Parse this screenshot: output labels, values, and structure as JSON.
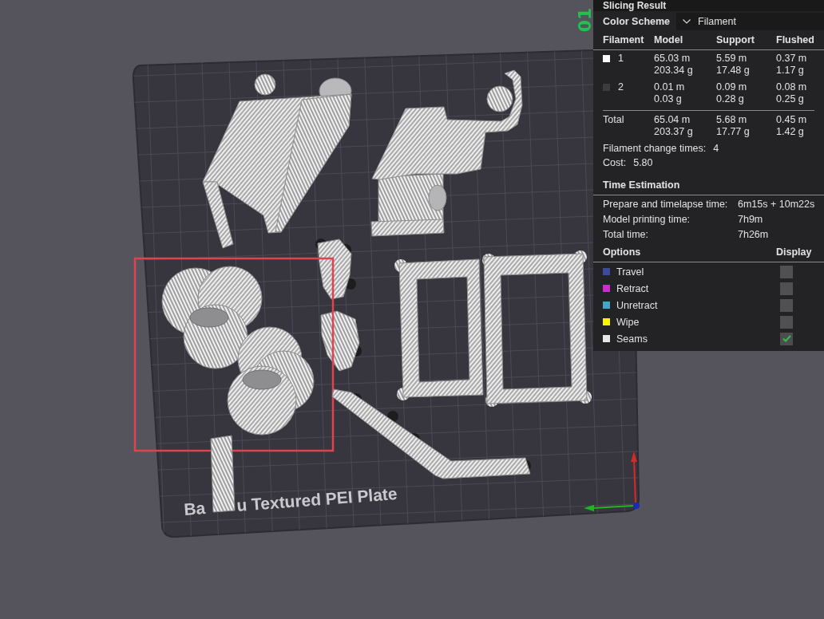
{
  "viewport": {
    "plate_number": "01",
    "plate_label_parts": [
      "Ba",
      "u Textured PEI Plate"
    ]
  },
  "slicing_result": {
    "title": "Slicing Result",
    "color_scheme": {
      "label": "Color Scheme",
      "value": "Filament"
    },
    "columns": [
      "Filament",
      "Model",
      "Support",
      "Flushed"
    ],
    "filaments": [
      {
        "number": "1",
        "color": "#ffffff",
        "cells": [
          {
            "length": "65.03 m",
            "weight": "203.34 g"
          },
          {
            "length": "5.59 m",
            "weight": "17.48 g"
          },
          {
            "length": "0.37 m",
            "weight": "1.17 g"
          }
        ]
      },
      {
        "number": "2",
        "color": "#3c3c3e",
        "cells": [
          {
            "length": "0.01 m",
            "weight": "0.03 g"
          },
          {
            "length": "0.09 m",
            "weight": "0.28 g"
          },
          {
            "length": "0.08 m",
            "weight": "0.25 g"
          }
        ]
      }
    ],
    "total": {
      "label": "Total",
      "cells": [
        {
          "length": "65.04 m",
          "weight": "203.37 g"
        },
        {
          "length": "5.68 m",
          "weight": "17.77 g"
        },
        {
          "length": "0.45 m",
          "weight": "1.42 g"
        }
      ]
    },
    "summary": [
      {
        "label": "Filament change times:",
        "value": "4"
      },
      {
        "label": "Cost:",
        "value": "5.80"
      }
    ]
  },
  "time_estimation": {
    "title": "Time Estimation",
    "rows": [
      {
        "label": "Prepare and timelapse time:",
        "value": "6m15s + 10m22s"
      },
      {
        "label": "Model printing time:",
        "value": "7h9m"
      },
      {
        "label": "Total time:",
        "value": "7h26m"
      }
    ]
  },
  "options": {
    "columns": [
      "Options",
      "Display"
    ],
    "items": [
      {
        "label": "Travel",
        "color": "#3c4b9a",
        "checked": false
      },
      {
        "label": "Retract",
        "color": "#c72ecb",
        "checked": false
      },
      {
        "label": "Unretract",
        "color": "#3fa8c9",
        "checked": false
      },
      {
        "label": "Wipe",
        "color": "#f5f500",
        "checked": false
      },
      {
        "label": "Seams",
        "color": "#e6e6e6",
        "checked": true
      }
    ]
  }
}
